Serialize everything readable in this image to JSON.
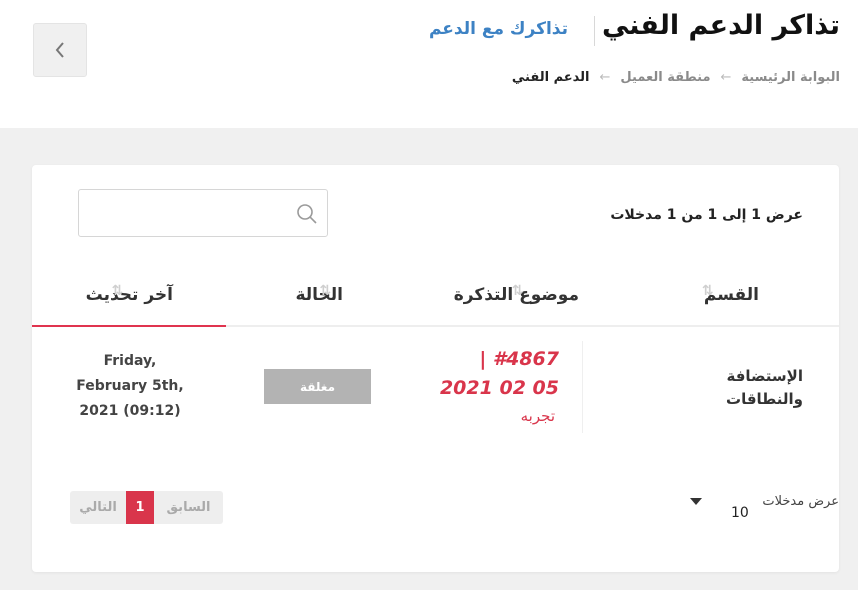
{
  "header": {
    "title": "تذاكر الدعم الفني",
    "tickets_link": "تذاكرك مع الدعم",
    "back_icon": "chevron-left-icon"
  },
  "breadcrumb": {
    "items": [
      "البوابة الرئيسية",
      "منطقة العميل",
      "الدعم الفني"
    ],
    "separator": "←"
  },
  "table_controls": {
    "showing_info": "عرض 1 إلى 1 من 1 مدخلات",
    "search_placeholder": "",
    "search_icon": "search-icon"
  },
  "table": {
    "columns": [
      "القسم",
      "موضوع التذكرة",
      "الحالة",
      "آخر تحديث"
    ],
    "sort_icon": "⇅",
    "rows": [
      {
        "section_line1": "الإستضافة",
        "section_line2": "والنطاقات",
        "ticket_id": "#4867 | 05 02 2021",
        "ticket_id_line1": "#4867 |",
        "ticket_id_line2": "05 02 2021",
        "ticket_title": "تجربه",
        "status": "مغلقة",
        "date_line1": "Friday,",
        "date_line2": "February 5th,",
        "date_line3": "2021 (09:12)"
      }
    ]
  },
  "footer": {
    "per_page_label": "عرض مدخلات",
    "per_page_value": "10",
    "pager": {
      "prev": "السابق",
      "current": "1",
      "next": "التالي"
    }
  },
  "colors": {
    "accent": "#d9354b",
    "link": "#3d82c4",
    "status_closed": "#b3b3b3"
  }
}
